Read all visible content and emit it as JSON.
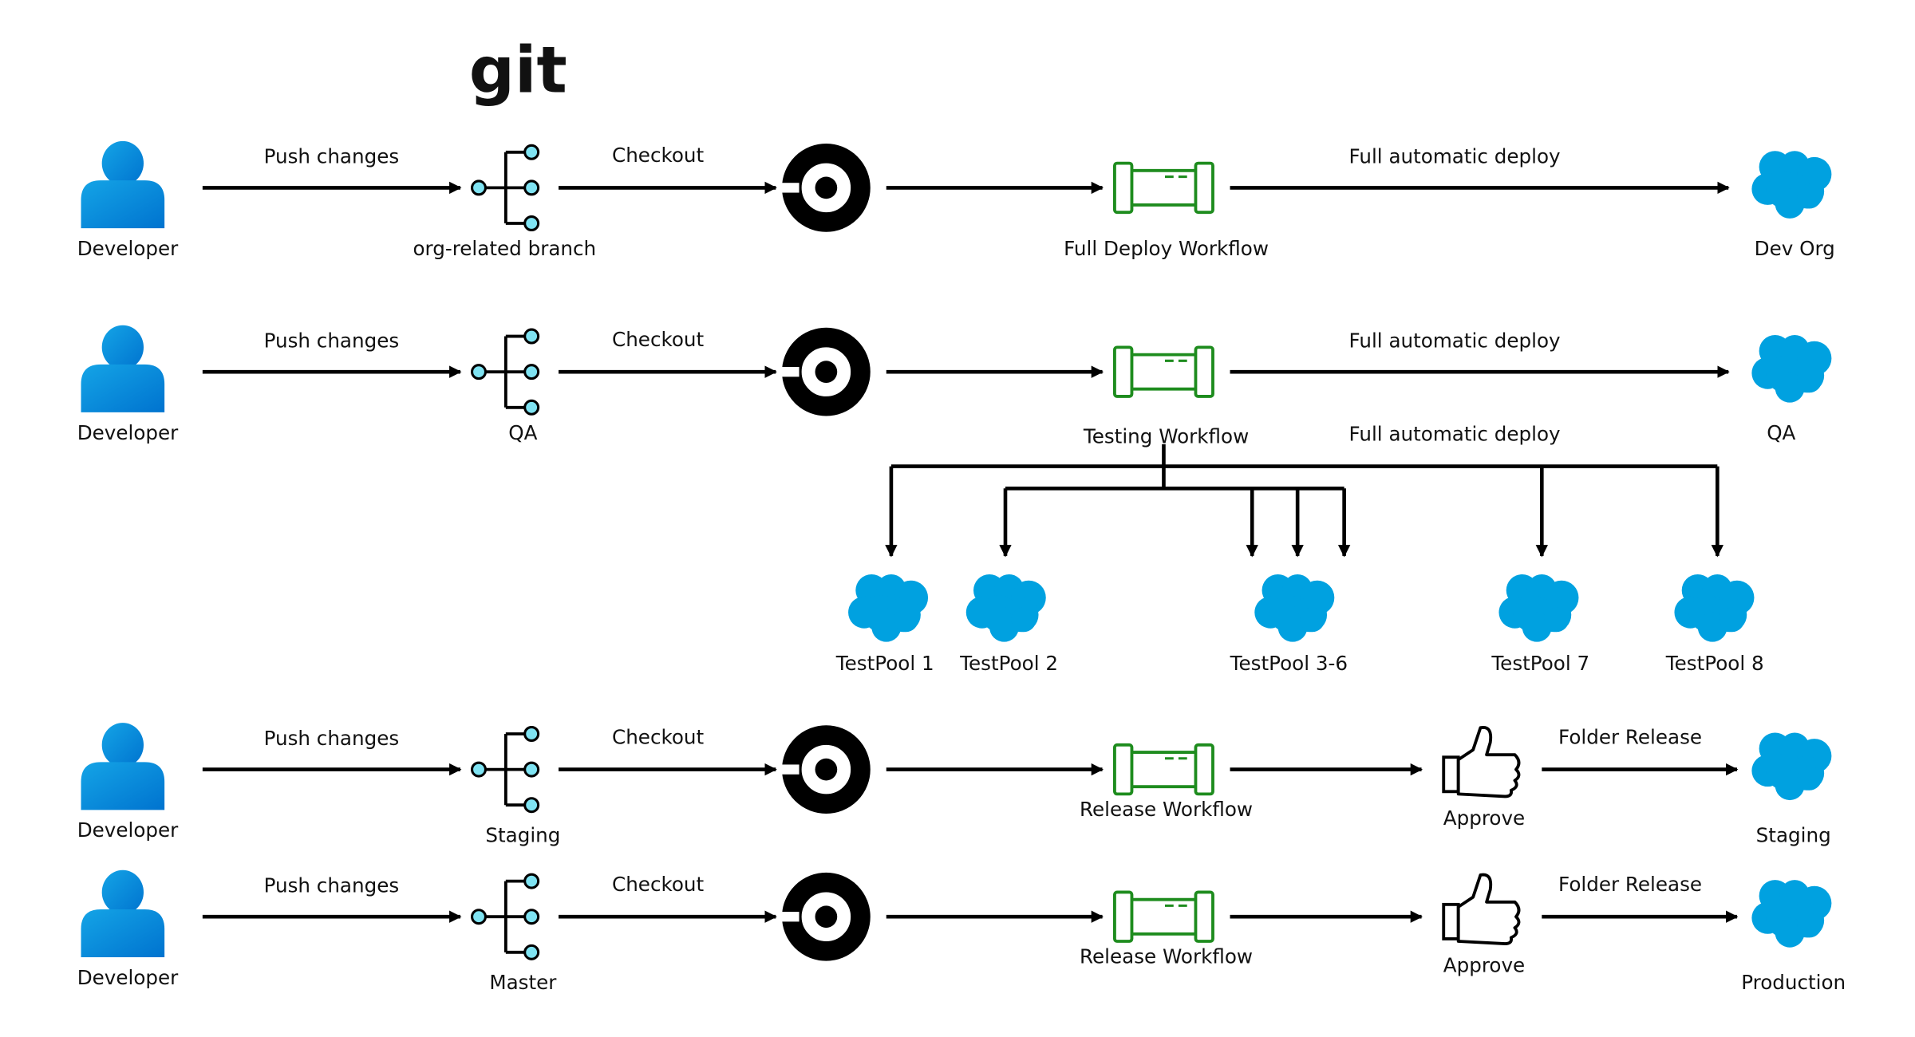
{
  "logo": {
    "text": "git",
    "color": "#DE5B40"
  },
  "colors": {
    "cloud": "#00A1E0",
    "workflow": "#1E8C1E",
    "branch_node": "#7FE3F2",
    "person_top": "#14A4E6",
    "person_bottom": "#0073CF"
  },
  "rows": [
    {
      "developer": "Developer",
      "push": "Push changes",
      "branch": "org-related branch",
      "checkout": "Checkout",
      "workflow": "Full Deploy Workflow",
      "deploy": "Full automatic deploy",
      "target": "Dev Org"
    },
    {
      "developer": "Developer",
      "push": "Push changes",
      "branch": "QA",
      "checkout": "Checkout",
      "workflow": "Testing Workflow",
      "deploy": "Full automatic deploy",
      "target": "QA"
    },
    {
      "developer": "Developer",
      "push": "Push changes",
      "branch": "Staging",
      "checkout": "Checkout",
      "workflow": "Release Workflow",
      "approve": "Approve",
      "deploy": "Folder Release",
      "target": "Staging"
    },
    {
      "developer": "Developer",
      "push": "Push changes",
      "branch": "Master",
      "checkout": "Checkout",
      "workflow": "Release Workflow",
      "approve": "Approve",
      "deploy": "Folder Release",
      "target": "Production"
    }
  ],
  "testing_fanout": {
    "label": "Full automatic deploy",
    "pools": [
      "TestPool 1",
      "TestPool 2",
      "TestPool 3-6",
      "TestPool 7",
      "TestPool 8"
    ]
  }
}
